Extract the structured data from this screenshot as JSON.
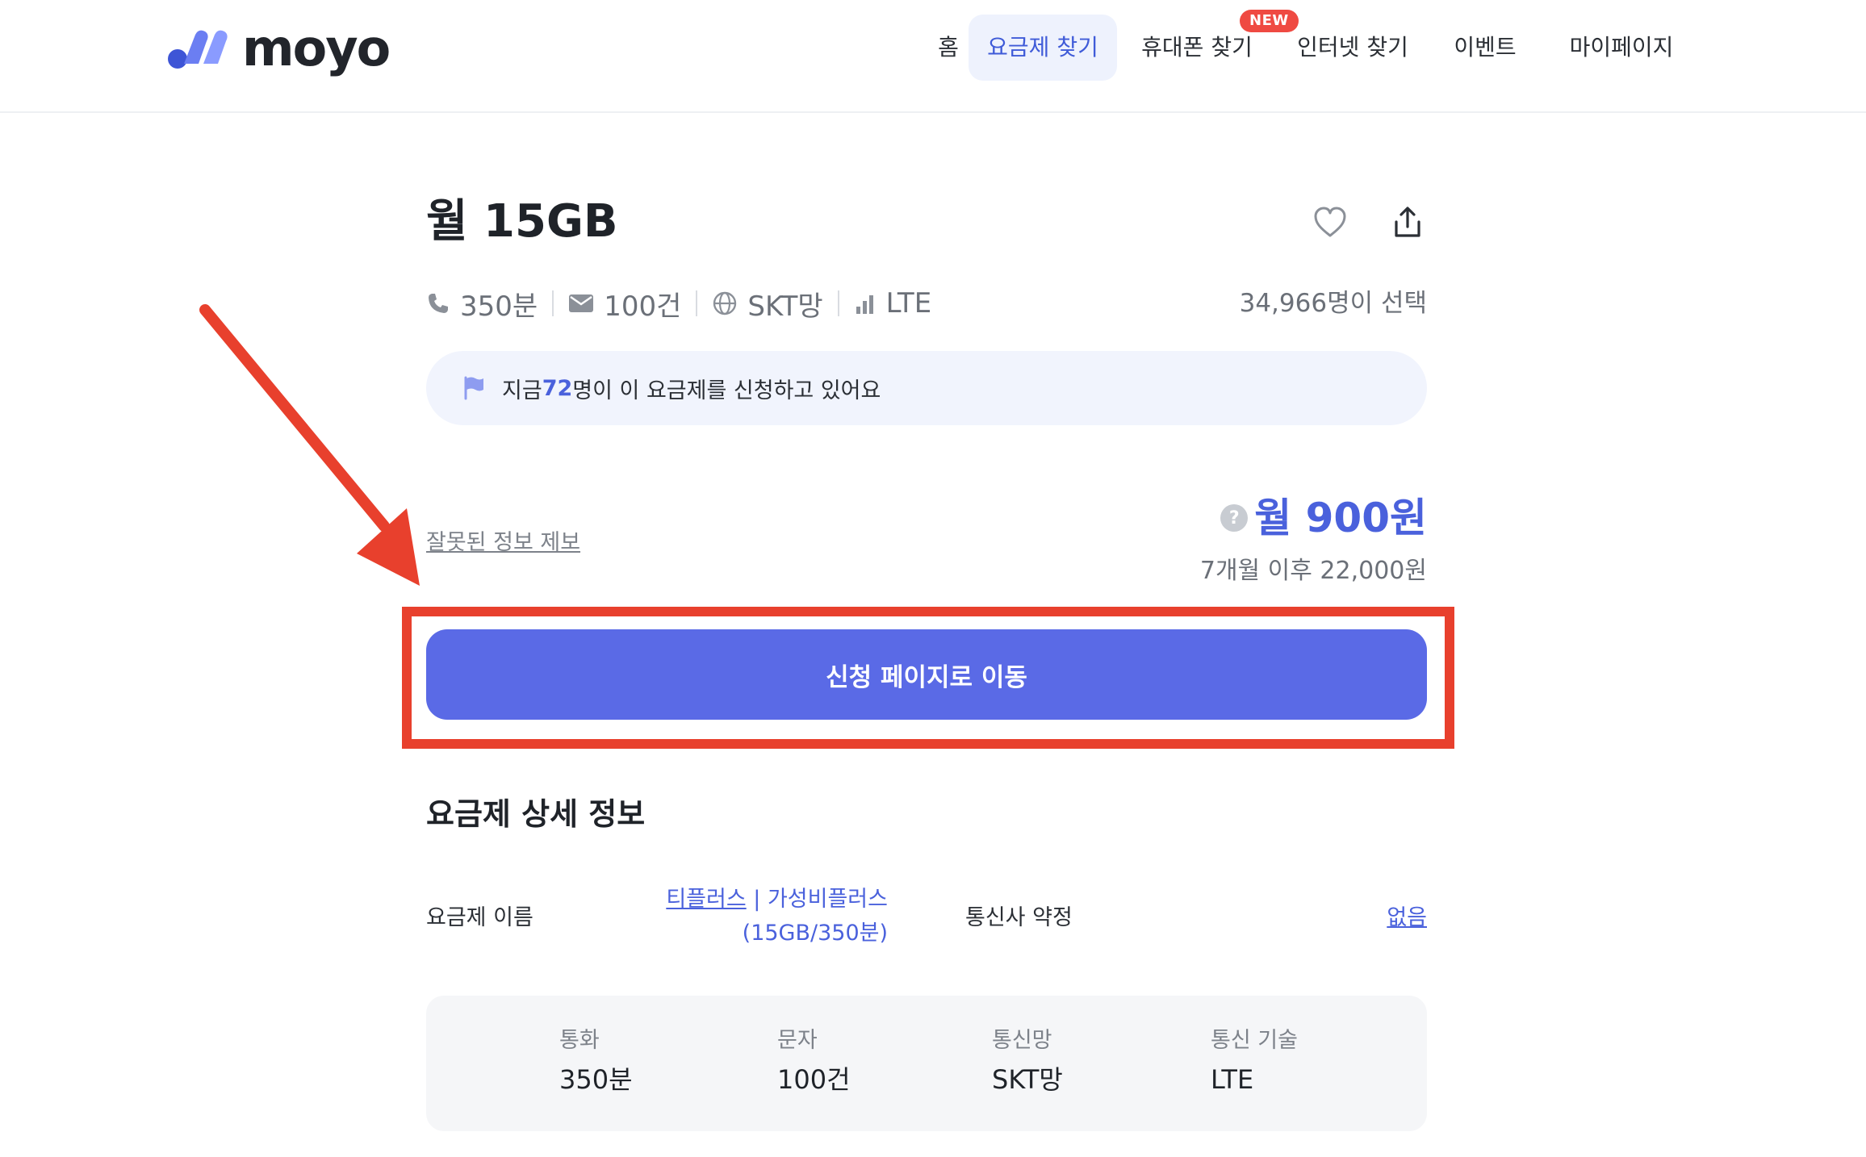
{
  "header": {
    "logo_text": "moyo",
    "nav": [
      {
        "label": "홈"
      },
      {
        "label": "요금제 찾기",
        "active": true
      },
      {
        "label": "휴대폰 찾기",
        "badge": "NEW"
      },
      {
        "label": "인터넷 찾기"
      },
      {
        "label": "이벤트"
      },
      {
        "label": "마이페이지"
      }
    ]
  },
  "plan": {
    "title": "월 15GB",
    "specs": {
      "call": "350분",
      "sms": "100건",
      "network": "SKT망",
      "tech": "LTE"
    },
    "selected_count": "34,966명이 선택",
    "notice": {
      "prefix": "지금 ",
      "count": "72",
      "suffix": "명이 이 요금제를 신청하고 있어요"
    },
    "report_link": "잘못된 정보 제보",
    "price_help": "?",
    "price": "월 900원",
    "price_after": "7개월 이후 22,000원",
    "cta_label": "신청 페이지로 이동"
  },
  "details": {
    "section_title": "요금제 상세 정보",
    "plan_name_label": "요금제 이름",
    "plan_name_carrier": "티플러스",
    "plan_name_rest": " | 가성비플러스",
    "plan_name_line2": "(15GB/350분)",
    "contract_label": "통신사 약정",
    "contract_value": "없음",
    "stats": [
      {
        "label": "통화",
        "value": "350분"
      },
      {
        "label": "문자",
        "value": "100건"
      },
      {
        "label": "통신망",
        "value": "SKT망"
      },
      {
        "label": "통신 기술",
        "value": "LTE"
      }
    ]
  },
  "colors": {
    "brand": "#5a6ae6",
    "accent_text": "#4a61dc",
    "highlight_box": "#e8402d",
    "new_badge": "#ef4a42"
  }
}
